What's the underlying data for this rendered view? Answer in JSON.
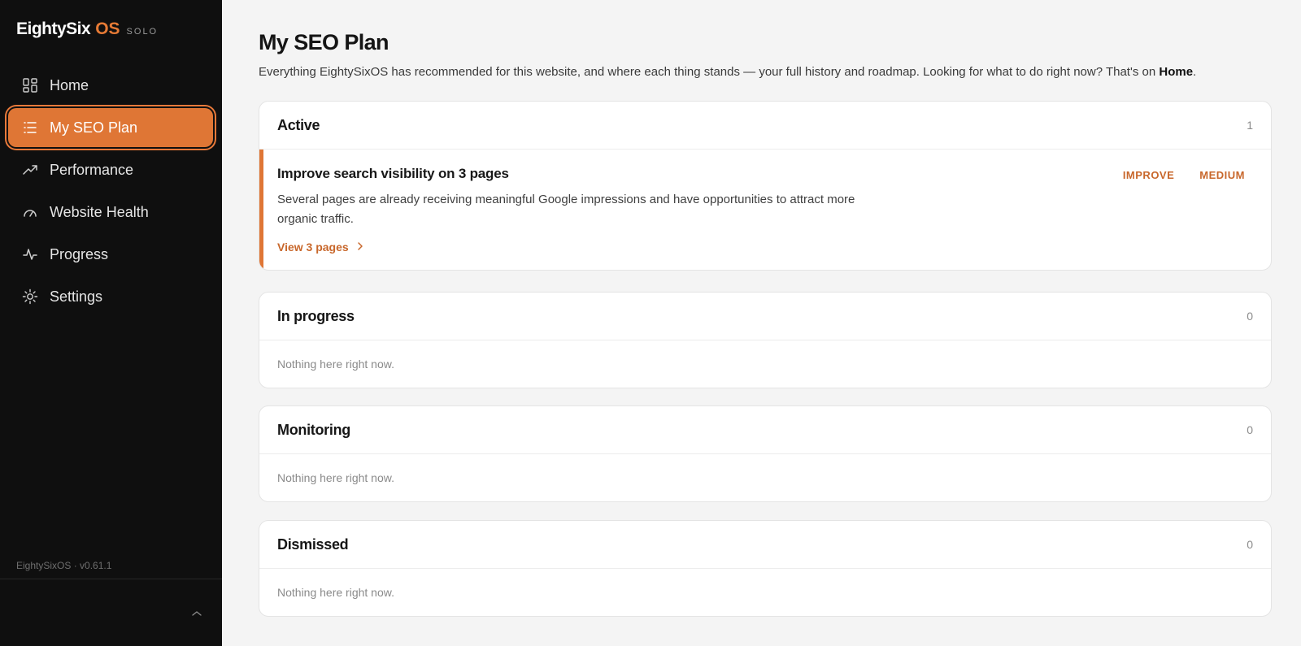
{
  "brand": {
    "name": "EightySix",
    "os": "OS",
    "tier": "SOLO"
  },
  "sidebar": {
    "items": [
      {
        "label": "Home",
        "icon": "grid-icon"
      },
      {
        "label": "My SEO Plan",
        "icon": "list-icon",
        "active": true
      },
      {
        "label": "Performance",
        "icon": "trending-up-icon"
      },
      {
        "label": "Website Health",
        "icon": "gauge-icon"
      },
      {
        "label": "Progress",
        "icon": "activity-icon"
      },
      {
        "label": "Settings",
        "icon": "gear-icon"
      }
    ],
    "version": "EightySixOS · v0.61.1"
  },
  "page": {
    "title": "My SEO Plan",
    "subtitle_text": "Everything EightySixOS has recommended for this website, and where each thing stands — your full history and roadmap. Looking for what to do right now? That's on ",
    "subtitle_link": "Home",
    "subtitle_end": "."
  },
  "sections": {
    "active": {
      "title": "Active",
      "count": "1",
      "item": {
        "title": "Improve search visibility on 3 pages",
        "description": "Several pages are already receiving meaningful Google impressions and have opportunities to attract more organic traffic.",
        "link": "View 3 pages",
        "tags": [
          "IMPROVE",
          "MEDIUM"
        ]
      }
    },
    "in_progress": {
      "title": "In progress",
      "count": "0",
      "empty": "Nothing here right now."
    },
    "monitoring": {
      "title": "Monitoring",
      "count": "0",
      "empty": "Nothing here right now."
    },
    "dismissed": {
      "title": "Dismissed",
      "count": "0",
      "empty": "Nothing here right now."
    }
  },
  "colors": {
    "accent": "#df7635",
    "sidebar_bg": "#0f0f0f",
    "page_bg": "#f4f4f4"
  }
}
